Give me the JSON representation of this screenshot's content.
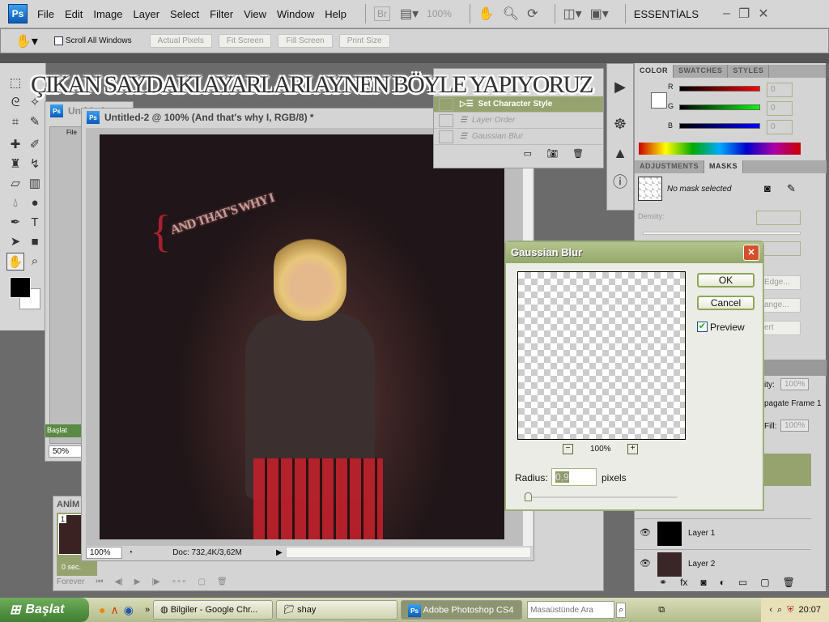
{
  "menubar": {
    "logo": "Ps",
    "items": [
      "File",
      "Edit",
      "Image",
      "Layer",
      "Select",
      "Filter",
      "View",
      "Window",
      "Help"
    ],
    "bridge": "Br",
    "zoom": "100%",
    "workspace": "ESSENTİALS"
  },
  "options": {
    "scroll_all": "Scroll All Windows",
    "buttons": [
      "Actual Pixels",
      "Fit Screen",
      "Fill Screen",
      "Print Size"
    ]
  },
  "overlay_text": "ÇIKAN SAYDAKI AYARLARI AYNEN BÖYLE YAPIYORUZ",
  "background_windows": {
    "title": "Untitled",
    "zoom": "50%",
    "start": "Başlat",
    "menu": "File"
  },
  "document": {
    "title": "Untitled-2 @ 100% (And that's why I, RGB/8) *",
    "canvas_text": "AND THAT'S WHY I",
    "brace": "{",
    "zoom": "100%",
    "doc_info": "Doc: 732,4K/3,62M"
  },
  "history": {
    "items": [
      {
        "label": "Set Character Style",
        "selected": true
      },
      {
        "label": "Layer Order",
        "selected": false
      },
      {
        "label": "Gaussian Blur",
        "selected": false
      }
    ]
  },
  "color_panel": {
    "tabs": [
      "COLOR",
      "SWATCHES",
      "STYLES"
    ],
    "channels": [
      {
        "label": "R",
        "value": "0",
        "color": "#ff0000"
      },
      {
        "label": "G",
        "value": "0",
        "color": "#00ff00"
      },
      {
        "label": "B",
        "value": "0",
        "color": "#0000ff"
      }
    ]
  },
  "masks_panel": {
    "tabs": [
      "ADJUSTMENTS",
      "MASKS"
    ],
    "status": "No mask selected",
    "density": "Density:",
    "buttons": [
      "Edge...",
      "ange...",
      "ert"
    ]
  },
  "layers_panel": {
    "opacity_label": "ity:",
    "opacity": "100%",
    "propagate": "pagate Frame 1",
    "fill_label": "Fill:",
    "fill": "100%",
    "layers": [
      "Layer 1",
      "Layer 2"
    ]
  },
  "gaussian_blur": {
    "title": "Gaussian Blur",
    "ok": "OK",
    "cancel": "Cancel",
    "preview": "Preview",
    "preview_checked": true,
    "zoom": "100%",
    "radius_label": "Radius:",
    "radius": "0,9",
    "unit": "pixels"
  },
  "animation": {
    "tab": "ANİM",
    "frame": "1",
    "delay": "0 sec.",
    "loop": "Forever"
  },
  "taskbar": {
    "start": "Başlat",
    "tasks": [
      "Bilgiler - Google Chr...",
      "shay",
      "Adobe Photoshop CS4"
    ],
    "search_placeholder": "Masaüstünde Ara",
    "time": "20:07"
  }
}
